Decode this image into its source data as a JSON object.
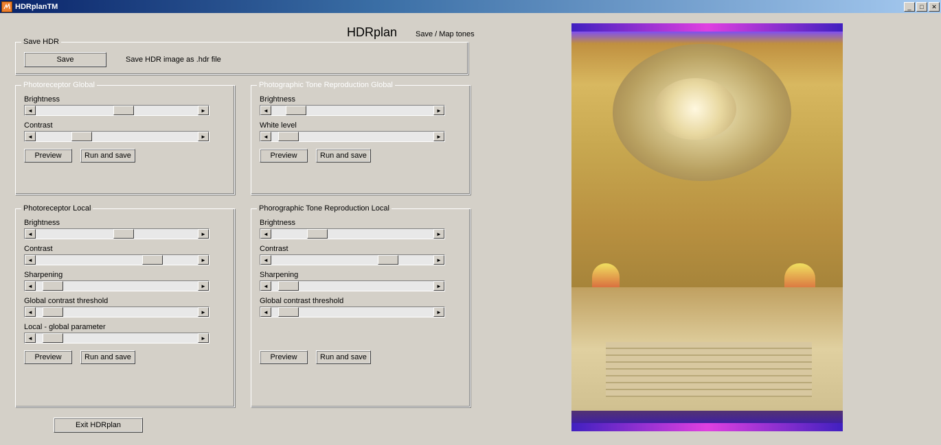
{
  "window": {
    "title": "HDRplanTM"
  },
  "header": {
    "title": "HDRplan",
    "subtitle": "Save / Map tones"
  },
  "save_panel": {
    "legend": "Save HDR",
    "save_btn": "Save",
    "desc": "Save HDR image as .hdr file"
  },
  "pg": {
    "legend": "Photoreceptor Global",
    "brightness": "Brightness",
    "contrast": "Contrast",
    "preview": "Preview",
    "run": "Run and save"
  },
  "ptg": {
    "legend": "Photographic Tone Reproduction Global",
    "brightness": "Brightness",
    "white": "White level",
    "preview": "Preview",
    "run": "Run and save"
  },
  "pl": {
    "legend": "Photoreceptor Local",
    "brightness": "Brightness",
    "contrast": "Contrast",
    "sharpening": "Sharpening",
    "gct": "Global contrast threshold",
    "lgp": "Local - global parameter",
    "preview": "Preview",
    "run": "Run and save"
  },
  "ptl": {
    "legend": "Phorographic Tone Reproduction Local",
    "brightness": "Brightness",
    "contrast": "Contrast",
    "sharpening": "Sharpening",
    "gct": "Global contrast threshold",
    "preview": "Preview",
    "run": "Run and save"
  },
  "exit_btn": "Exit HDRplan",
  "sliders": {
    "pg_brightness": 55,
    "pg_contrast": 25,
    "ptg_brightness": 10,
    "ptg_white": 5,
    "pl_brightness": 55,
    "pl_contrast": 75,
    "pl_sharp": 5,
    "pl_gct": 5,
    "pl_lgp": 5,
    "ptl_brightness": 25,
    "ptl_contrast": 75,
    "ptl_sharp": 5,
    "ptl_gct": 5
  }
}
